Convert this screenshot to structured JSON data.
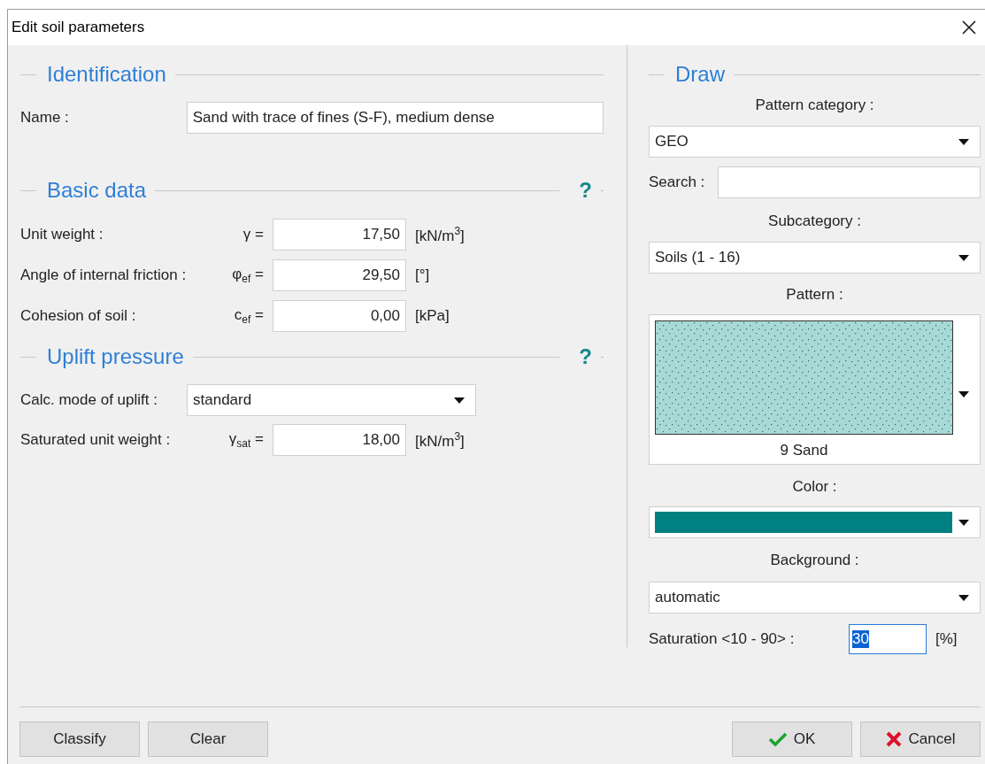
{
  "window": {
    "title": "Edit soil parameters"
  },
  "identification": {
    "heading": "Identification",
    "name_label": "Name :",
    "name_value": "Sand with trace of fines (S-F), medium dense"
  },
  "basic_data": {
    "heading": "Basic data",
    "help": "?",
    "rows": [
      {
        "label": "Unit weight :",
        "symbol": "γ =",
        "value": "17,50",
        "unit": "[kN/m$^{3}$]"
      },
      {
        "label": "Angle of internal friction :",
        "symbol": "φ$_{ef}$ =",
        "value": "29,50",
        "unit": "[°]"
      },
      {
        "label": "Cohesion of soil :",
        "symbol": "c$_{ef}$ =",
        "value": "0,00",
        "unit": "[kPa]"
      }
    ]
  },
  "uplift": {
    "heading": "Uplift pressure",
    "help": "?",
    "mode_label": "Calc. mode of uplift :",
    "mode_value": "standard",
    "rows": [
      {
        "label": "Saturated unit weight :",
        "symbol": "γ$_{sat}$ =",
        "value": "18,00",
        "unit": "[kN/m$^{3}$]"
      }
    ]
  },
  "draw": {
    "heading": "Draw",
    "pattern_category_label": "Pattern category :",
    "pattern_category_value": "GEO",
    "search_label": "Search :",
    "subcategory_label": "Subcategory :",
    "subcategory_value": "Soils (1 - 16)",
    "pattern_label": "Pattern :",
    "pattern_name": "9 Sand",
    "color_label": "Color :",
    "color": "#008080",
    "background_label": "Background :",
    "background_value": "automatic",
    "saturation_label": "Saturation <10 - 90> :",
    "saturation_value": "30",
    "saturation_text_selected": true,
    "saturation_unit": "[%]"
  },
  "buttons": [
    {
      "label": "Classify",
      "kind": "plain"
    },
    {
      "label": "Clear",
      "kind": "plain"
    },
    {
      "label": "OK",
      "kind": "ok"
    },
    {
      "label": "Cancel",
      "kind": "cancel"
    }
  ]
}
